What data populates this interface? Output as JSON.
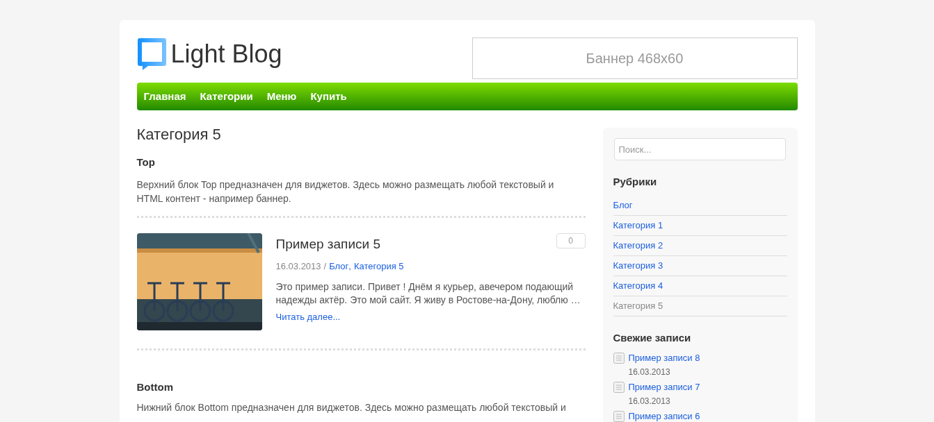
{
  "logo": {
    "title": "Light Blog"
  },
  "banner": {
    "text": "Баннер 468x60"
  },
  "nav": [
    {
      "label": "Главная"
    },
    {
      "label": "Категории"
    },
    {
      "label": "Меню"
    },
    {
      "label": "Купить"
    }
  ],
  "page_title": "Категория 5",
  "top_widget": {
    "title": "Top",
    "text": "Верхний блок Top предназначен для виджетов. Здесь можно размещать любой текстовый и HTML контент - например баннер."
  },
  "posts": [
    {
      "title": "Пример записи 5",
      "comments": "0",
      "date": "16.03.2013",
      "separator": "/",
      "category_separator": ",",
      "categories": [
        "Блог",
        "Категория 5"
      ],
      "excerpt": "Это пример записи. Привет ! Днём я курьер, авечером подающий надежды актёр. Это мой сайт. Я живу в Ростове-на-Дону, люблю …",
      "read_more": "Читать далее...",
      "image": {
        "kind": "picture"
      }
    }
  ],
  "bottom_widget": {
    "title": "Bottom",
    "text": "Нижний блок Bottom предназначен для виджетов. Здесь можно размещать любой текстовый и"
  },
  "sidebar": {
    "search": {
      "placeholder": "Поиск..."
    },
    "categories_title": "Рубрики",
    "categories": [
      {
        "label": "Блог",
        "selected": false
      },
      {
        "label": "Категория 1",
        "selected": false
      },
      {
        "label": "Категория 2",
        "selected": false
      },
      {
        "label": "Категория 3",
        "selected": false
      },
      {
        "label": "Категория 4",
        "selected": false
      },
      {
        "label": "Категория 5",
        "selected": true
      }
    ],
    "recent_title": "Свежие записи",
    "recent": [
      {
        "title": "Пример записи 8",
        "date": "16.03.2013"
      },
      {
        "title": "Пример записи 7",
        "date": "16.03.2013"
      },
      {
        "title": "Пример записи 6"
      }
    ]
  }
}
